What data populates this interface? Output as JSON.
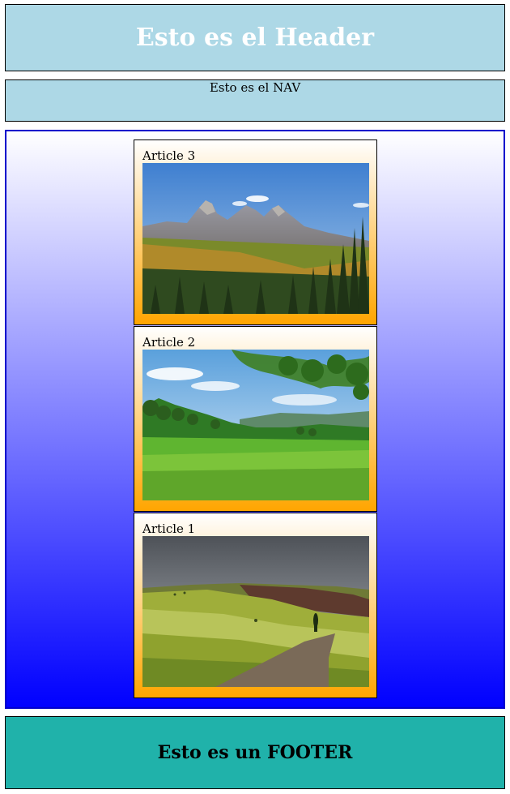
{
  "header": {
    "title": "Esto es el Header"
  },
  "nav": {
    "text": "Esto es el NAV"
  },
  "articles": [
    {
      "title": "Article 3",
      "image": "mountain-landscape"
    },
    {
      "title": "Article 2",
      "image": "green-meadow-landscape"
    },
    {
      "title": "Article 1",
      "image": "rolling-hills-road-landscape"
    }
  ],
  "footer": {
    "text": "Esto es un FOOTER"
  },
  "colors": {
    "header_bg": "#add8e6",
    "nav_bg": "#add8e6",
    "main_gradient_top": "#ffffff",
    "main_gradient_bottom": "#0000ff",
    "article_gradient_bottom": "#ffa500",
    "footer_bg": "#20b2aa"
  }
}
